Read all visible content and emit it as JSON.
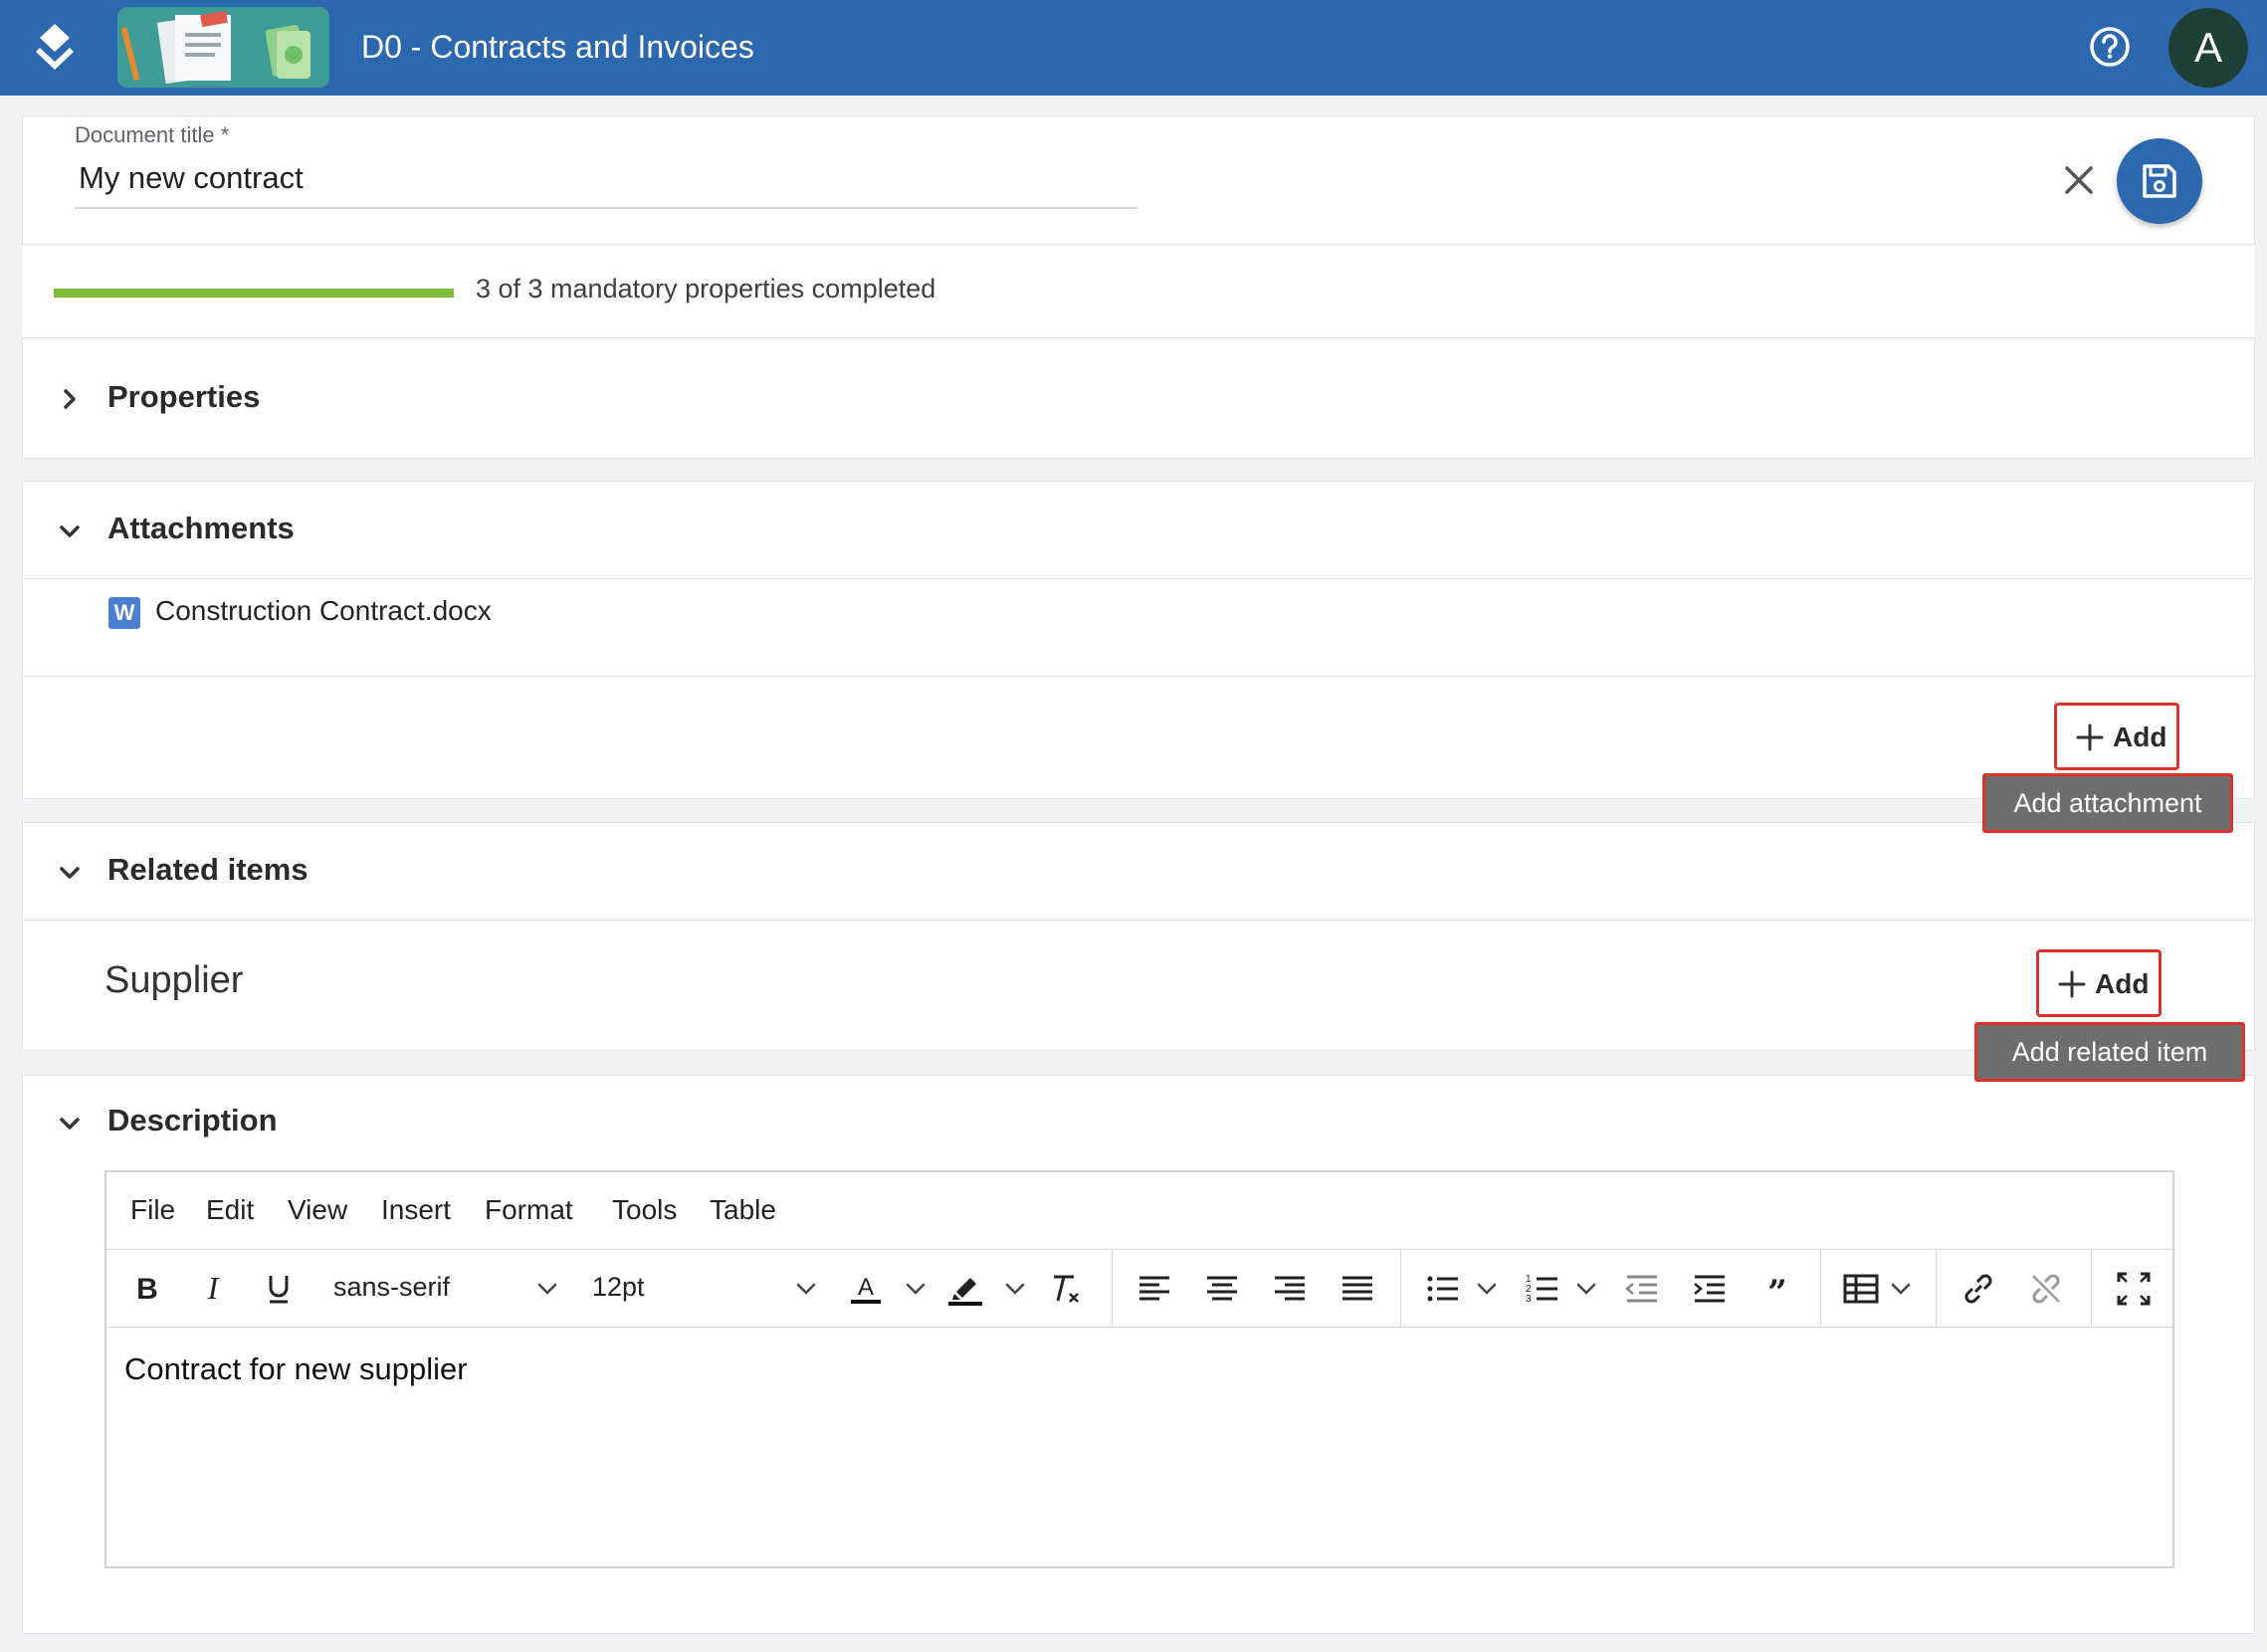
{
  "header": {
    "app_title": "D0 - Contracts and Invoices",
    "avatar_initial": "A",
    "brand_color": "#2c68ae"
  },
  "document": {
    "title_label": "Document title *",
    "title_value": "My new contract"
  },
  "progress": {
    "completed": 3,
    "total": 3,
    "text": "3 of 3 mandatory properties completed"
  },
  "sections": {
    "properties": {
      "title": "Properties",
      "expanded": false
    },
    "attachments": {
      "title": "Attachments",
      "expanded": true,
      "items": [
        {
          "icon": "W",
          "name": "Construction Contract.docx"
        }
      ],
      "add_label": "Add",
      "add_tooltip": "Add attachment"
    },
    "related_items": {
      "title": "Related items",
      "expanded": true,
      "group_label": "Supplier",
      "add_label": "Add",
      "add_tooltip": "Add related item"
    },
    "description": {
      "title": "Description",
      "expanded": true,
      "menu": [
        "File",
        "Edit",
        "View",
        "Insert",
        "Format",
        "Tools",
        "Table"
      ],
      "font_family": "sans-serif",
      "font_size": "12pt",
      "content": "Contract for new supplier"
    }
  }
}
